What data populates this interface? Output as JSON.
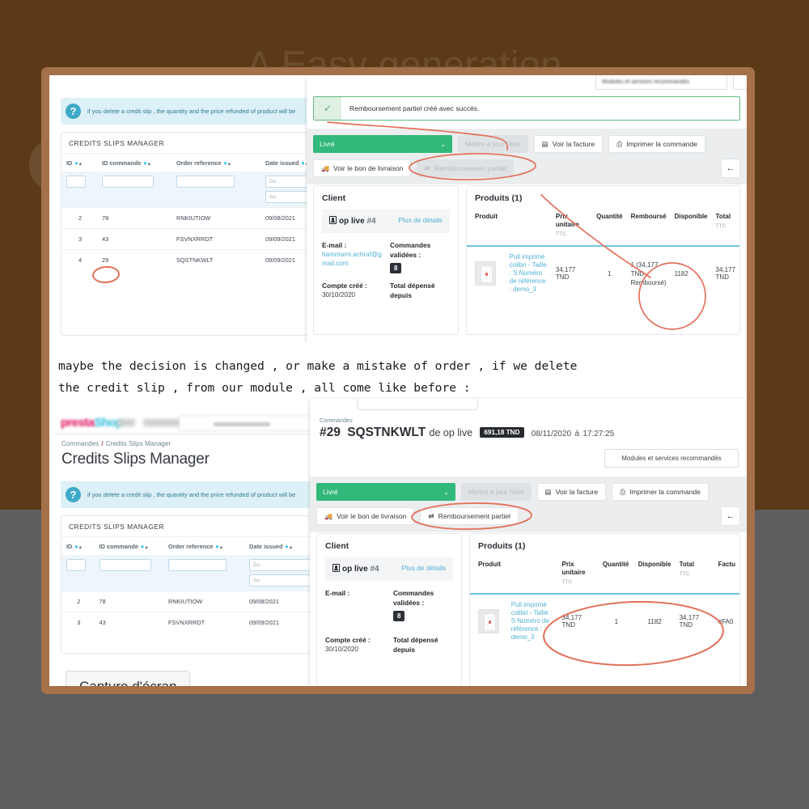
{
  "background": {
    "watermark": "A Easy generation",
    "top_color": "#5c3a17",
    "bottom_color": "#5e5e5e",
    "frame_color": "#a5714a"
  },
  "caption": {
    "line1": "maybe the decision is changed , or make a mistake of order , if we delete",
    "line2": "the credit slip , from our module , all come like before :"
  },
  "capture_button": {
    "label": "Capture d'écran"
  },
  "credit_slips": {
    "breadcrumb_parent": "Commandes",
    "breadcrumb_sep": "/",
    "breadcrumb_current": "Credits Slips Manager",
    "page_title": "Credits Slips Manager",
    "info_text": "if you delete a credit slip , the quantity and the price refunded of product will be",
    "panel_title": "CREDITS SLIPS MANAGER",
    "columns": [
      "ID",
      "ID commande",
      "Order reference",
      "Date issued"
    ],
    "filter_from_placeholder": "Du",
    "filter_to_placeholder": "Au",
    "rows_top": [
      {
        "id": "2",
        "id_commande": "78",
        "reference": "RNKIUTIOW",
        "date": "09/08/2021"
      },
      {
        "id": "3",
        "id_commande": "43",
        "reference": "FSVNXRRDT",
        "date": "09/09/2021"
      },
      {
        "id": "4",
        "id_commande": "29",
        "reference": "SQSTNKWLT",
        "date": "09/09/2021"
      }
    ],
    "rows_bottom": [
      {
        "id": "2",
        "id_commande": "78",
        "reference": "RNKIUTIOW",
        "date": "09/08/2021"
      },
      {
        "id": "3",
        "id_commande": "43",
        "reference": "FSVNXRRDT",
        "date": "09/09/2021"
      }
    ]
  },
  "order_top": {
    "reco_button": "Modules et services recommandés",
    "alert_message": "Remboursement partiel créé avec succès.",
    "status_value": "Livré",
    "btn_update_state": "Mettre à jour l'état",
    "btn_view_invoice": "Voir la facture",
    "btn_print_order": "Imprimer la commande",
    "btn_delivery_slip": "Voir le bon de livraison",
    "btn_partial_refund": "Remboursement partiel",
    "client_card_title": "Client",
    "customer_name": "op live",
    "customer_id": "#4",
    "more_details": "Plus de détails",
    "email_label": "E-mail :",
    "email_value": "hammami.achraf@gmail.com",
    "orders_label": "Commandes validées :",
    "orders_count": "8",
    "account_label": "Compte créé :",
    "account_value": "30/10/2020",
    "spent_label": "Total dépensé depuis",
    "products_title": "Produits (1)",
    "product_columns": [
      "Produit",
      "Prix unitaire",
      "Quantité",
      "Remboursé",
      "Disponible",
      "Total"
    ],
    "ttc": "TTC",
    "product_name": "Pull imprimé colibri - Taille : S Numéro de référence : demo_3",
    "unit_price": "34,177 TND",
    "quantity": "1",
    "refunded": "1 (34,177 TND Remboursé)",
    "available": "1182",
    "total": "34,177 TND"
  },
  "order_bottom": {
    "breadcrumb": "Commandes",
    "order_number": "#29",
    "order_reference": "SQSTNKWLT",
    "order_by": "de op live",
    "order_total": "691,18 TND",
    "order_date": "08/11/2020",
    "order_date_sep": "à",
    "order_time": "17:27:25",
    "reco_button": "Modules et services recommandés",
    "status_value": "Livré",
    "btn_update_state": "Mettre à jour l'état",
    "btn_view_invoice": "Voir la facture",
    "btn_print_order": "Imprimer la commande",
    "btn_delivery_slip": "Voir le bon de livraison",
    "btn_partial_refund": "Remboursement partiel",
    "client_card_title": "Client",
    "customer_name": "op live",
    "customer_id": "#4",
    "more_details": "Plus de détails",
    "email_label": "E-mail :",
    "orders_label": "Commandes validées :",
    "orders_count": "8",
    "account_label": "Compte créé :",
    "account_value": "30/10/2020",
    "spent_label": "Total dépensé depuis",
    "products_title": "Produits (1)",
    "product_columns": [
      "Produit",
      "Prix unitaire",
      "Quantité",
      "Disponible",
      "Total",
      "Factu"
    ],
    "ttc": "TTC",
    "product_name": "Pull imprimé colibri - Taille : S Numéro de référence : demo_3",
    "unit_price": "34,177 TND",
    "quantity": "1",
    "available": "1182",
    "total": "34,177 TND",
    "invoice": "#FA0"
  },
  "icons": {
    "question": "?",
    "check": "✓",
    "chevron_down": "⌄",
    "calendar": "▦",
    "truck": "🚚",
    "invoice": "▤",
    "printer": "⎙",
    "refund": "⇄",
    "back_arrow": "←",
    "sort_down": "▼",
    "sort_up": "▲"
  }
}
